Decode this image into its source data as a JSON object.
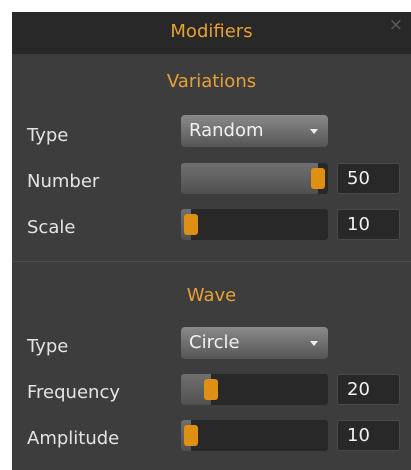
{
  "panel": {
    "title": "Modifiers",
    "close_symbol": "×",
    "close_icon": "close-icon"
  },
  "colors": {
    "accent": "#e8a035",
    "panel_bg": "#3d3d3d",
    "titlebar_bg": "#282828",
    "slider_handle": "#de8f14",
    "text": "#e4e4e4"
  },
  "variations": {
    "heading": "Variations",
    "type": {
      "label": "Type",
      "value": "Random",
      "arrow_icon": "chevron-down-icon"
    },
    "number": {
      "label": "Number",
      "value": "50",
      "level": 1.0
    },
    "scale": {
      "label": "Scale",
      "value": "10",
      "level": 0.0
    }
  },
  "wave": {
    "heading": "Wave",
    "type": {
      "label": "Type",
      "value": "Circle",
      "arrow_icon": "chevron-down-icon"
    },
    "frequency": {
      "label": "Frequency",
      "value": "20",
      "level": 0.16
    },
    "amplitude": {
      "label": "Amplitude",
      "value": "10",
      "level": 0.0
    }
  }
}
